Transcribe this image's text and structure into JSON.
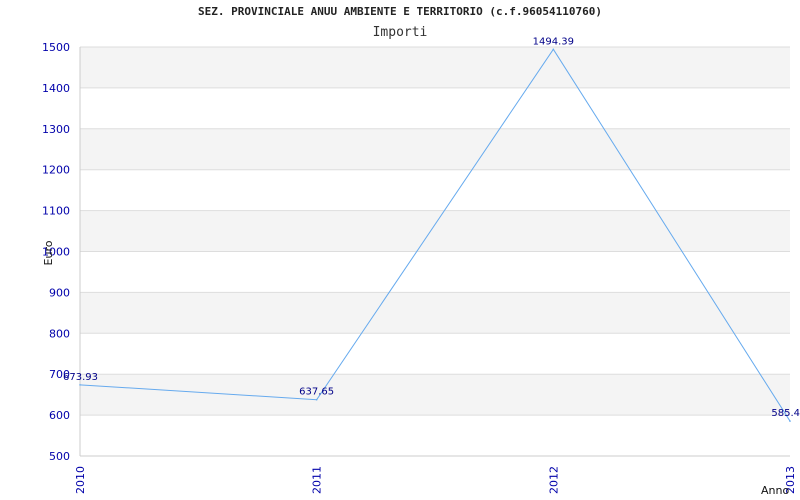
{
  "chart_data": {
    "type": "line",
    "title": "SEZ. PROVINCIALE ANUU AMBIENTE E TERRITORIO (c.f.96054110760)",
    "subtitle": "Importi",
    "xlabel": "Anno",
    "ylabel": "Euro",
    "ylim": [
      500,
      1500
    ],
    "yticks": [
      500,
      600,
      700,
      800,
      900,
      1000,
      1100,
      1200,
      1300,
      1400,
      1500
    ],
    "categories": [
      "2010",
      "2011",
      "2012",
      "2013"
    ],
    "series": [
      {
        "values": [
          673.93,
          637.65,
          1494.39,
          585.4
        ],
        "labels": [
          "673.93",
          "637.65",
          "1494.39",
          "585.4"
        ],
        "color": "#66aaee"
      }
    ],
    "grid": true,
    "band_color": "#f4f4f4",
    "grid_color": "#dddddd",
    "tick_color": "#0000aa"
  }
}
